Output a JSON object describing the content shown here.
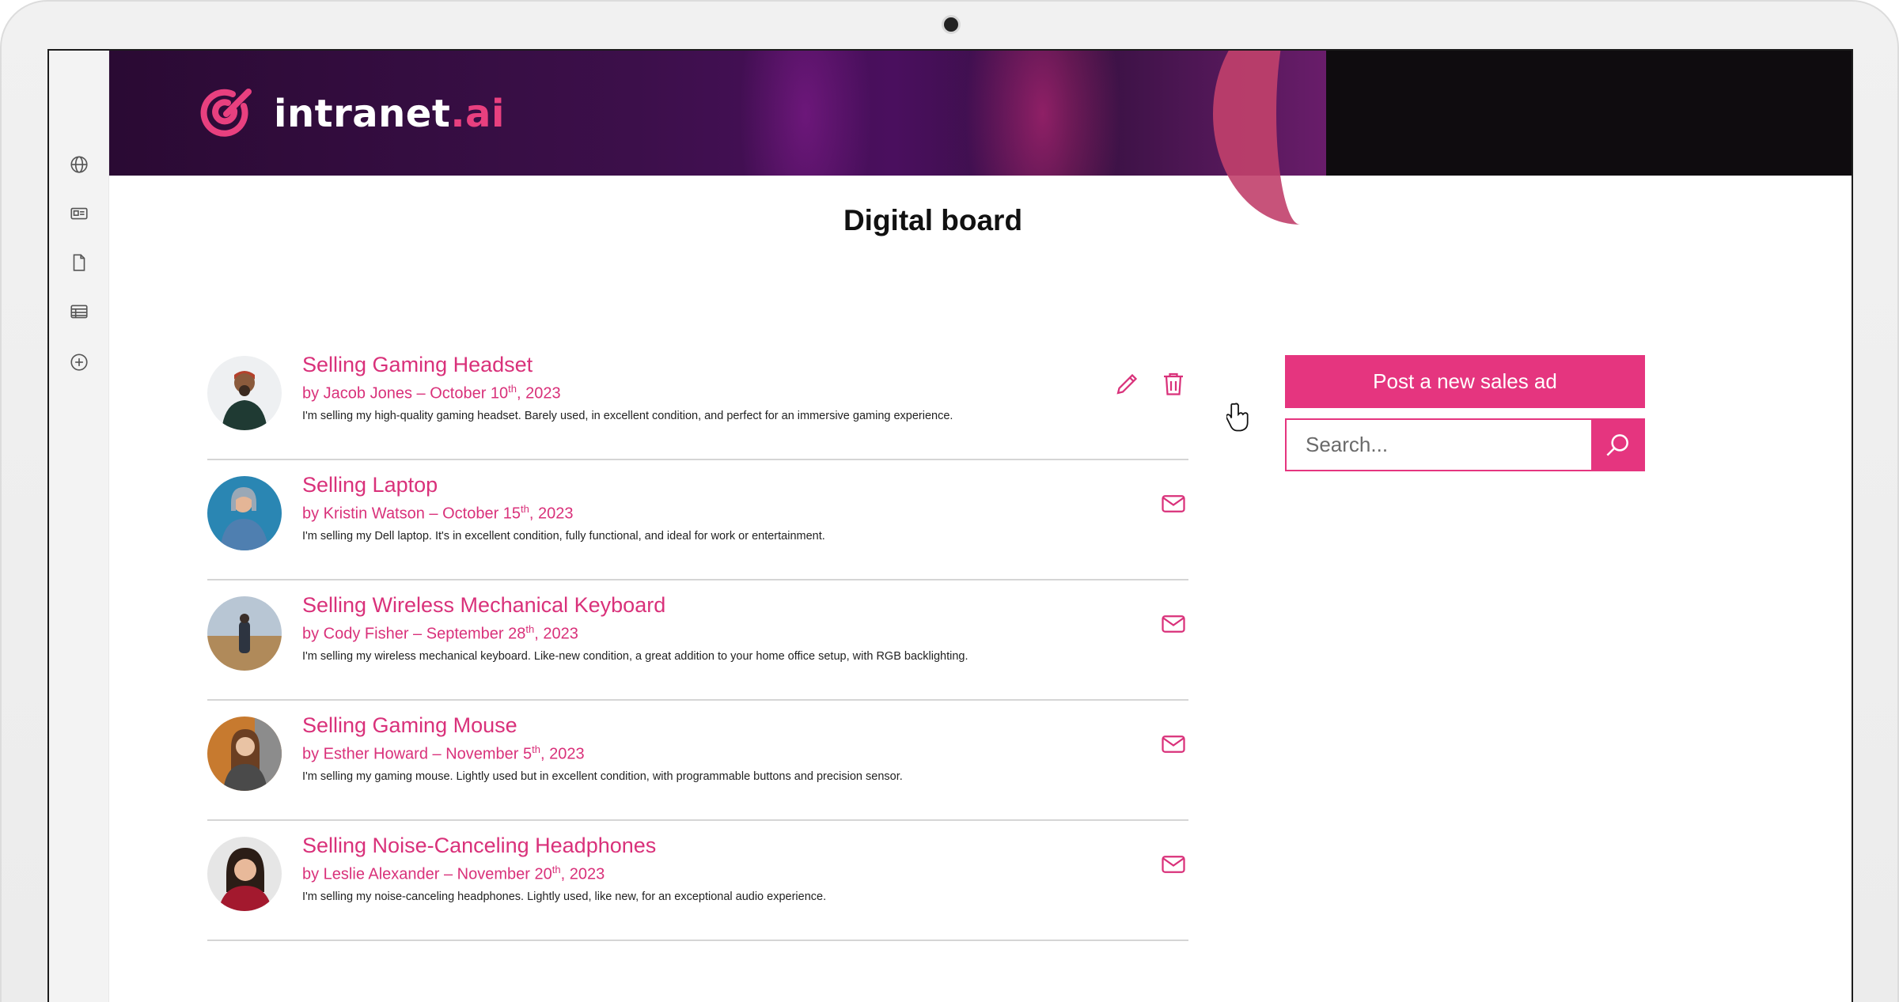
{
  "brand": {
    "name": "intranet",
    "suffix": ".ai",
    "accent": "#e5357f"
  },
  "rail": {
    "icons": [
      "globe-icon",
      "news-icon",
      "document-icon",
      "table-icon",
      "add-circle-icon"
    ]
  },
  "page": {
    "title": "Digital board"
  },
  "ads": [
    {
      "title": "Selling Gaming Headset",
      "by": "by Jacob Jones – October 10",
      "ord": "th",
      "year": ", 2023",
      "desc": "I'm selling my high-quality gaming headset. Barely used, in excellent condition, and perfect for an immersive gaming experience.",
      "own": true
    },
    {
      "title": "Selling Laptop",
      "by": "by Kristin Watson – October 15",
      "ord": "th",
      "year": ", 2023",
      "desc": "I'm selling my Dell laptop. It's in excellent condition, fully functional, and ideal for work or entertainment.",
      "own": false
    },
    {
      "title": "Selling Wireless Mechanical Keyboard",
      "by": "by Cody Fisher –  September 28",
      "ord": "th",
      "year": ", 2023",
      "desc": "I'm selling my wireless mechanical keyboard. Like-new condition, a great addition to your home office setup, with RGB backlighting.",
      "own": false
    },
    {
      "title": "Selling Gaming Mouse",
      "by": "by Esther Howard – November 5",
      "ord": "th",
      "year": ", 2023",
      "desc": "I'm selling my gaming mouse. Lightly used but in excellent condition, with programmable buttons and precision sensor.",
      "own": false
    },
    {
      "title": "Selling Noise-Canceling Headphones",
      "by": "by Leslie Alexander – November 20",
      "ord": "th",
      "year": ", 2023",
      "desc": "I'm selling my noise-canceling headphones. Lightly used, like new, for an exceptional audio experience.",
      "own": false
    }
  ],
  "sidebar": {
    "post_label": "Post a new sales ad",
    "search_placeholder": "Search..."
  }
}
